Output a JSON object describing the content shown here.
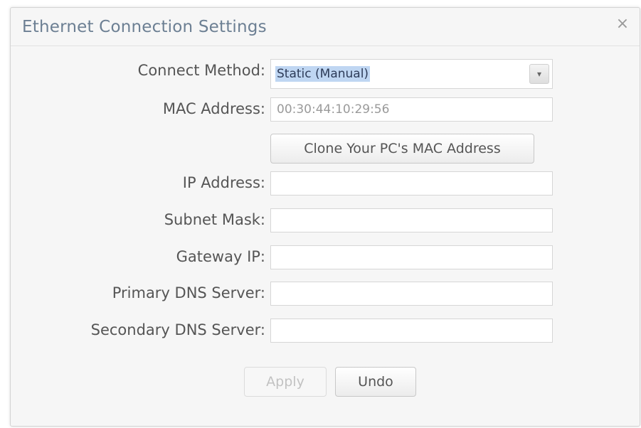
{
  "dialog": {
    "title": "Ethernet Connection Settings",
    "close_glyph": "×",
    "close_icon": "close-icon"
  },
  "form": {
    "connect_method": {
      "label": "Connect Method:",
      "value": "Static (Manual)",
      "arrow_glyph": "▾",
      "arrow_icon": "chevron-down-icon"
    },
    "mac_address": {
      "label": "MAC Address:",
      "value": "00:30:44:10:29:56"
    },
    "clone_button": "Clone Your PC's MAC Address",
    "ip_address": {
      "label": "IP Address:",
      "value": ""
    },
    "subnet_mask": {
      "label": "Subnet Mask:",
      "value": ""
    },
    "gateway_ip": {
      "label": "Gateway IP:",
      "value": ""
    },
    "primary_dns": {
      "label": "Primary DNS Server:",
      "value": ""
    },
    "secondary_dns": {
      "label": "Secondary DNS Server:",
      "value": ""
    }
  },
  "actions": {
    "apply": "Apply",
    "undo": "Undo"
  }
}
